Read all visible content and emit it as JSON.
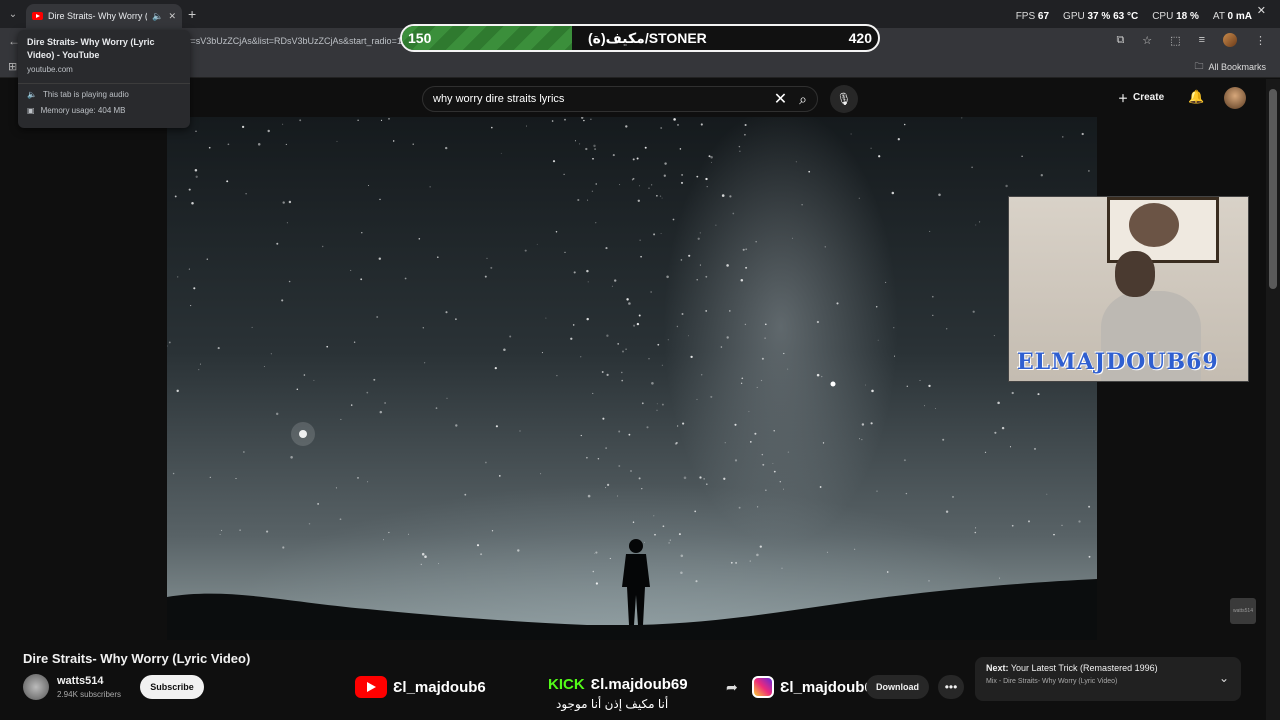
{
  "browser": {
    "tab_title": "Dire Straits- Why Worry (Lyric Video) - YouTube",
    "tab_title_short": "Dire Straits- Why Worry (Ly",
    "url": "v=sV3bUzZCjAs&list=RDsV3bUzZCjAs&start_radio=1",
    "bookmarks_label": "All Bookmarks",
    "hover_card": {
      "title": "Dire Straits- Why Worry (Lyric Video) - YouTube",
      "domain": "youtube.com",
      "audio_status": "This tab is playing audio",
      "memory": "Memory usage: 404 MB"
    }
  },
  "overlay_stats": {
    "fps_label": "FPS",
    "fps": "67",
    "gpu_label": "GPU",
    "gpu": "37 % 63 °C",
    "cpu_label": "CPU",
    "cpu": "18 %",
    "bat_label": "AT",
    "bat": "0 mA"
  },
  "stream_bar": {
    "left_value": "150",
    "middle_text": "(ة)مكيف/STONER",
    "right_value": "420",
    "progress": 0.357
  },
  "youtube": {
    "search_query": "why worry dire straits lyrics",
    "create_label": "Create"
  },
  "webcam": {
    "name": "ELMAJDOUB69"
  },
  "video": {
    "title": "Dire Straits- Why Worry (Lyric Video)",
    "watermark": "watts514",
    "channel_name": "watts514",
    "subscribers": "2.94K subscribers",
    "subscribe_label": "Subscribe",
    "download_label": "Download",
    "caption": "أنا مكيف إذن أنا موجود"
  },
  "socials": {
    "youtube_handle": "Ɛl_majdoub6",
    "kick_label": "KICK",
    "kick_handle": "Ɛl.majdoub69",
    "instagram_handle": "Ɛl_majdoub69"
  },
  "next_up": {
    "label": "Next:",
    "title": "Your Latest Trick (Remastered 1996)",
    "subtitle": "Mix - Dire Straits- Why Worry (Lyric Video)"
  },
  "colors": {
    "youtube_red": "#ff0000",
    "kick_green": "#53fc18",
    "bar_green": "#3b8f3b"
  }
}
